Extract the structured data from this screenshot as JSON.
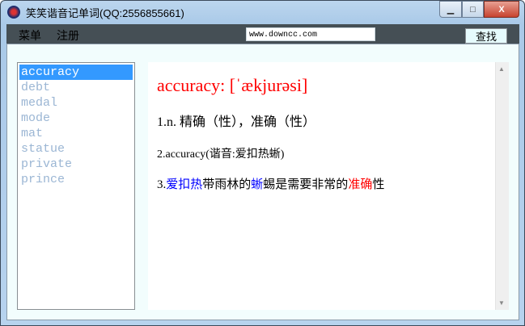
{
  "window": {
    "title": "笑笑谐音记单词(QQ:2556855661)",
    "minimize": "▁",
    "maximize": "□",
    "close": "X"
  },
  "menu": {
    "items": [
      "菜单",
      "注册"
    ],
    "url": "www.downcc.com",
    "find_label": "查找"
  },
  "words": [
    "accuracy",
    "debt",
    "medal",
    "mode",
    "mat",
    "statue",
    "private",
    "prince"
  ],
  "selected_index": 0,
  "entry": {
    "headword": "accuracy: [ˈækjurəsi]",
    "line1": "1.n. 精确（性），准确（性）",
    "line2": "2.accuracy(谐音:爱扣热蜥)",
    "line3": {
      "p1": "3.",
      "p2": "爱扣热",
      "p3": "带雨林的",
      "p4": "蜥",
      "p5": "蜴是需要非常的",
      "p6": "准确",
      "p7": "性"
    }
  },
  "colors": {
    "menubar": "#454f55",
    "selection": "#3399ff",
    "headword": "#ff0000",
    "highlight_blue": "#0000ff"
  }
}
